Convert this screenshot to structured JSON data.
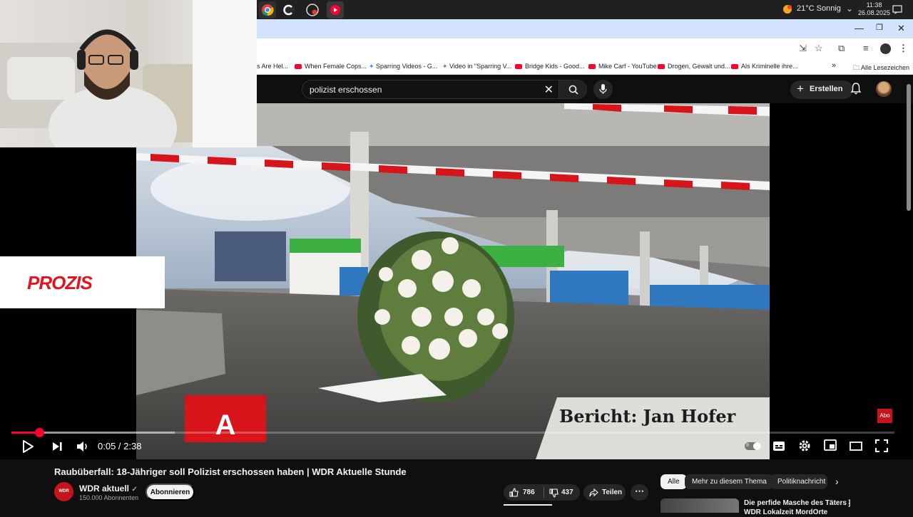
{
  "taskbar": {
    "weather": "21°C  Sonnig",
    "time": "11:38",
    "date": "26.08.2025"
  },
  "browser": {
    "bookmarks": [
      {
        "label": "s Are Hel..."
      },
      {
        "label": "When Female Cops..."
      },
      {
        "label": "Sparring Videos - G..."
      },
      {
        "label": "Video in \"Sparring V..."
      },
      {
        "label": "Bridge Kids - Good..."
      },
      {
        "label": "Mike Carf - YouTube"
      },
      {
        "label": "Drogen, Gewalt und..."
      },
      {
        "label": "Als Kriminelle ihre..."
      }
    ],
    "all_bookmarks": "Alle Lesezeichen",
    "more_bookmarks": "»"
  },
  "youtube": {
    "search_query": "polizist erschossen",
    "create_label": "Erstellen"
  },
  "video": {
    "lower_third": "Bericht: Jan Hofer",
    "station_letter": "A",
    "sponsor": "PROZIS",
    "abo_badge": "Abo",
    "time_display": "0:05 / 2:38",
    "progress_fraction": 0.0316,
    "buffer_fraction": 0.185,
    "accent": "#ff0033"
  },
  "watch": {
    "title": "Raubüberfall: 18-Jähriger soll Polizist erschossen haben | WDR Aktuelle Stunde",
    "channel_name": "WDR aktuell",
    "channel_logo_text": "WDR",
    "subscribers": "150.000 Abonnenten",
    "subscribe_label": "Abonnieren",
    "likes": "786",
    "dislikes": "437",
    "share_label": "Teilen"
  },
  "recommendations": {
    "chips": [
      {
        "label": "Alle"
      },
      {
        "label": "Mehr zu diesem Thema"
      },
      {
        "label": "Politiknachricht"
      }
    ],
    "first_title": "Die perfide Masche des Täters | WDR Lokalzeit MordOrte"
  }
}
